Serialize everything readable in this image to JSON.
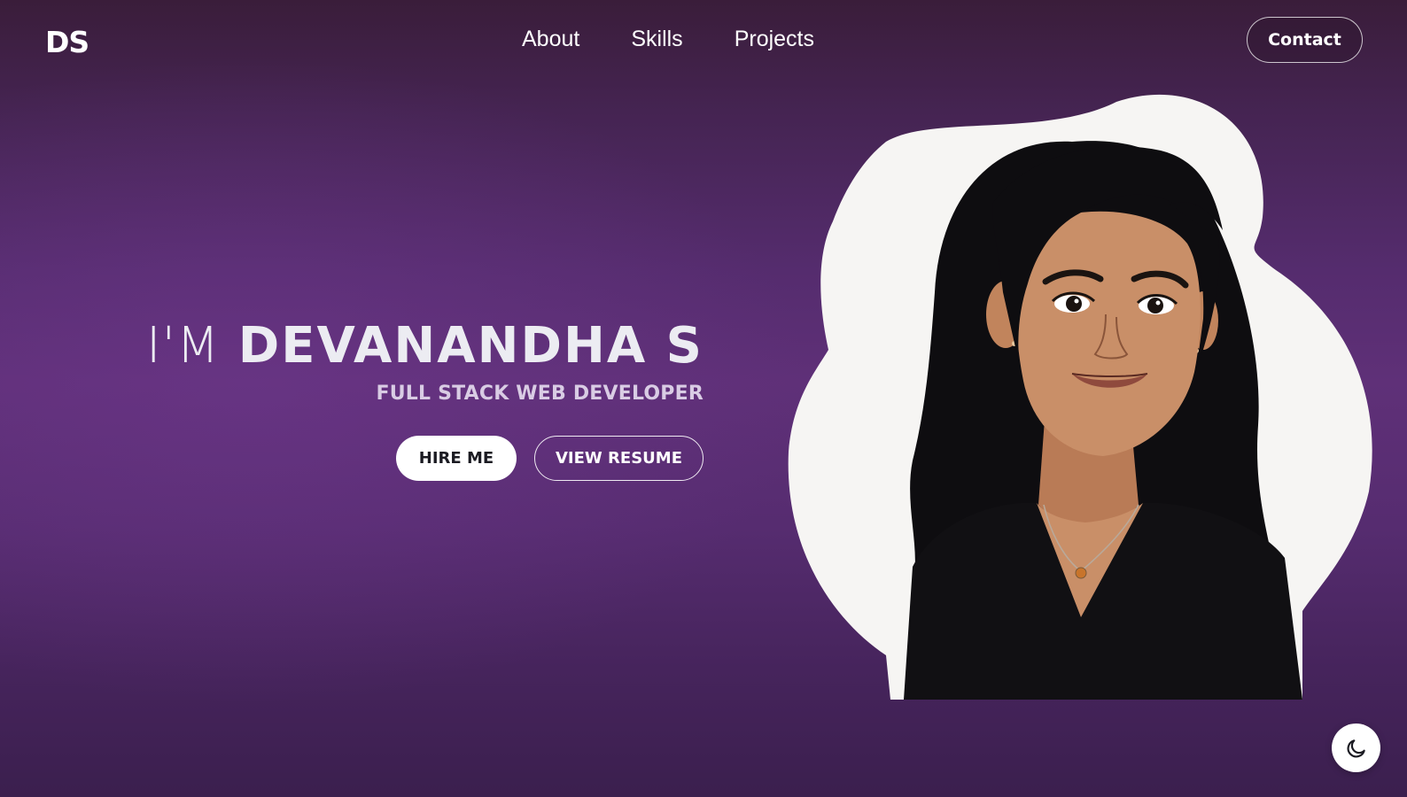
{
  "header": {
    "logo": "DS",
    "nav": [
      {
        "label": "About"
      },
      {
        "label": "Skills"
      },
      {
        "label": "Projects"
      }
    ],
    "contact_label": "Contact"
  },
  "hero": {
    "prefix": "I'M",
    "name": "DEVANANDHA S",
    "role": "FULL STACK WEB DEVELOPER",
    "hire_label": "HIRE ME",
    "resume_label": "VIEW RESUME"
  },
  "icons": {
    "theme_toggle": "moon-icon",
    "portrait": "avatar-illustration"
  },
  "colors": {
    "bg_top": "#3a1d3a",
    "bg_mid": "#5f3078",
    "blob": "#f6f5f3",
    "hair": "#0e0d10",
    "skin": "#c98f68"
  }
}
